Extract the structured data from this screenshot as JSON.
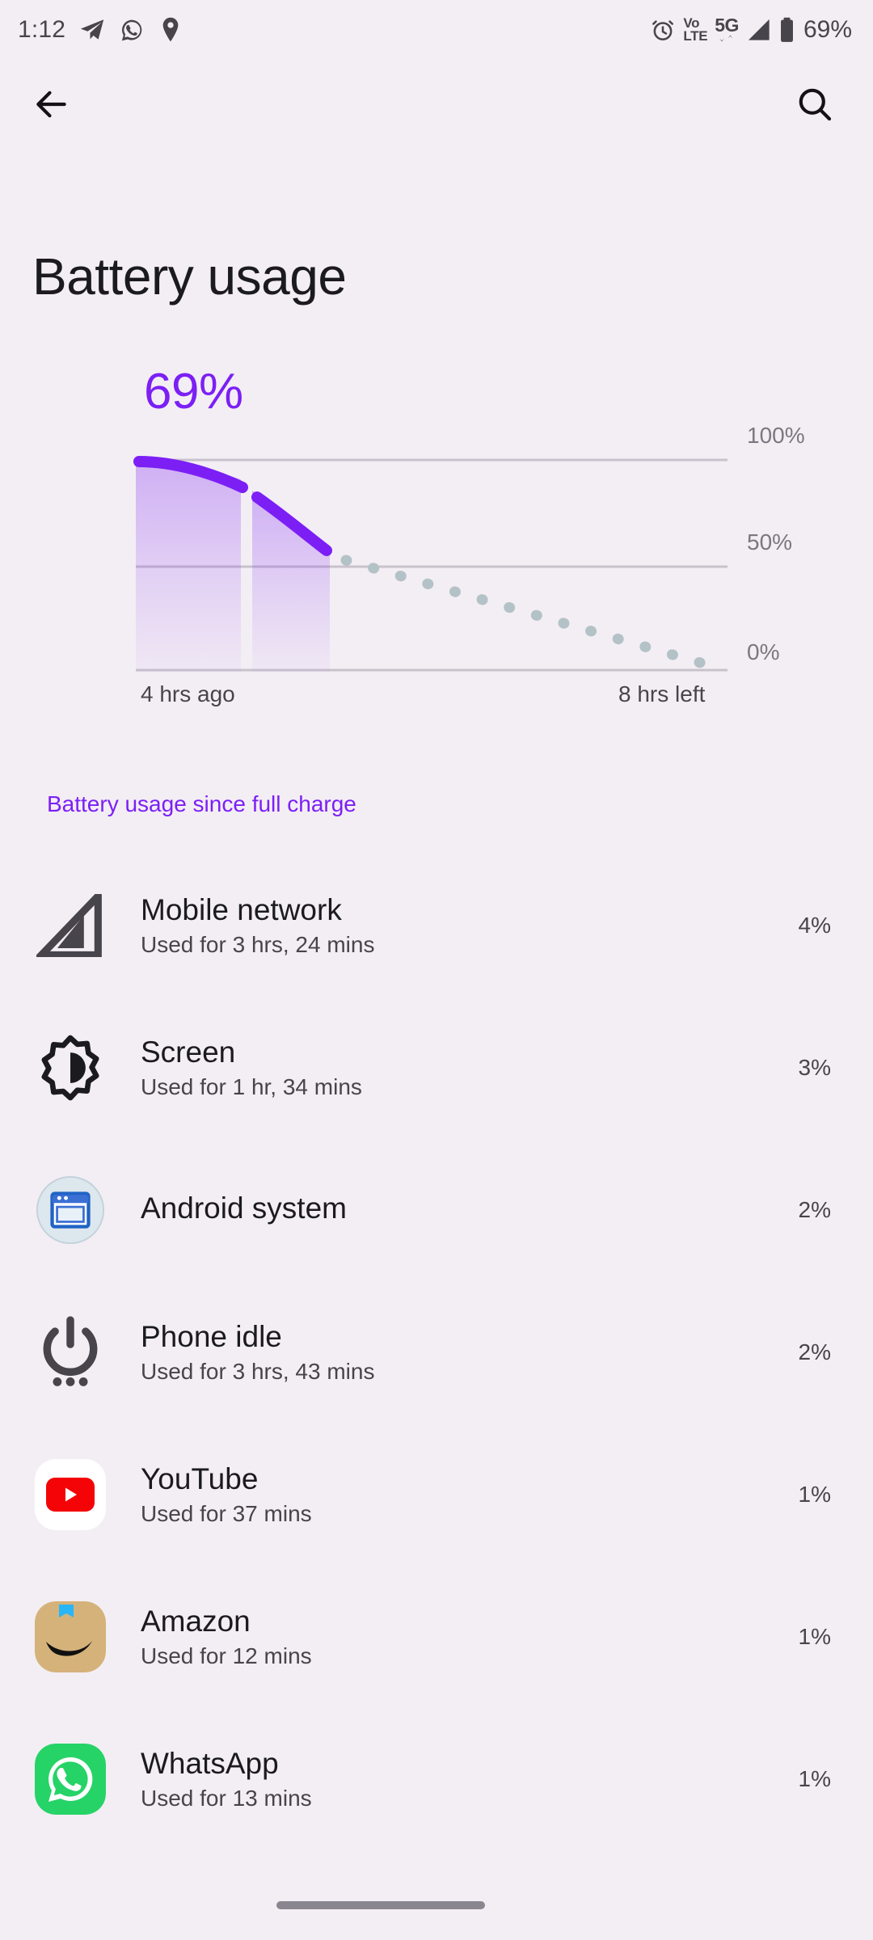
{
  "accent_purple": "#7c1ff5",
  "background": "#f3eef4",
  "text_primary": "#1b1b1f",
  "text_secondary": "#48444b",
  "axis_gray": "#7d7680",
  "statusbar": {
    "time": "1:12",
    "left_icons": [
      "telegram-icon",
      "whatsapp-icon",
      "location-pin-icon"
    ],
    "right_icons": [
      "alarm-icon",
      "volte-icon",
      "5g-icon",
      "signal-bars-icon",
      "battery-icon"
    ],
    "volte_top": "Vo",
    "volte_bottom": "LTE",
    "network_label": "5G",
    "battery_percent": "69%"
  },
  "actionbar": {
    "back_label": "back-arrow",
    "search_label": "search"
  },
  "header": {
    "title": "Battery usage"
  },
  "chart_data": {
    "type": "area",
    "title": "Battery usage",
    "current_level_label": "69%",
    "xlabel": "",
    "ylabel": "",
    "ylim": [
      0,
      100
    ],
    "y_ticks": [
      "0%",
      "50%",
      "100%"
    ],
    "y_tick_values": [
      0,
      50,
      100
    ],
    "x_axis_left_label": "4 hrs ago",
    "x_axis_right_label": "8 hrs left",
    "grid": true,
    "legend": "none",
    "series": [
      {
        "name": "Past battery level",
        "style": "solid-line-with-gradient-fill",
        "color": "#7c1ff5",
        "points": [
          {
            "x": 0,
            "y": 100
          },
          {
            "x": 1,
            "y": 96
          },
          {
            "x": 2,
            "y": 88
          },
          {
            "x": 3,
            "y": 84
          },
          {
            "x": 4,
            "y": 69
          }
        ]
      },
      {
        "name": "Projected battery level",
        "style": "dotted-line",
        "color": "#b3c2c7",
        "points": [
          {
            "x": 4,
            "y": 69
          },
          {
            "x": 8,
            "y": 40
          },
          {
            "x": 12,
            "y": 0
          }
        ]
      }
    ]
  },
  "list_section": {
    "header": "Battery usage since full charge",
    "rows": [
      {
        "icon": "signal-bars-icon",
        "title": "Mobile network",
        "subtitle": "Used for 3 hrs, 24 mins",
        "percent": "4%"
      },
      {
        "icon": "screen-brightness-icon",
        "title": "Screen",
        "subtitle": "Used for 1 hr, 34 mins",
        "percent": "3%"
      },
      {
        "icon": "android-system-icon",
        "title": "Android system",
        "subtitle": "",
        "percent": "2%"
      },
      {
        "icon": "power-idle-icon",
        "title": "Phone idle",
        "subtitle": "Used for 3 hrs, 43 mins",
        "percent": "2%"
      },
      {
        "icon": "youtube-icon",
        "title": "YouTube",
        "subtitle": "Used for 37 mins",
        "percent": "1%"
      },
      {
        "icon": "amazon-icon",
        "title": "Amazon",
        "subtitle": "Used for 12 mins",
        "percent": "1%"
      },
      {
        "icon": "whatsapp-icon",
        "title": "WhatsApp",
        "subtitle": "Used for 13 mins",
        "percent": "1%"
      }
    ]
  }
}
